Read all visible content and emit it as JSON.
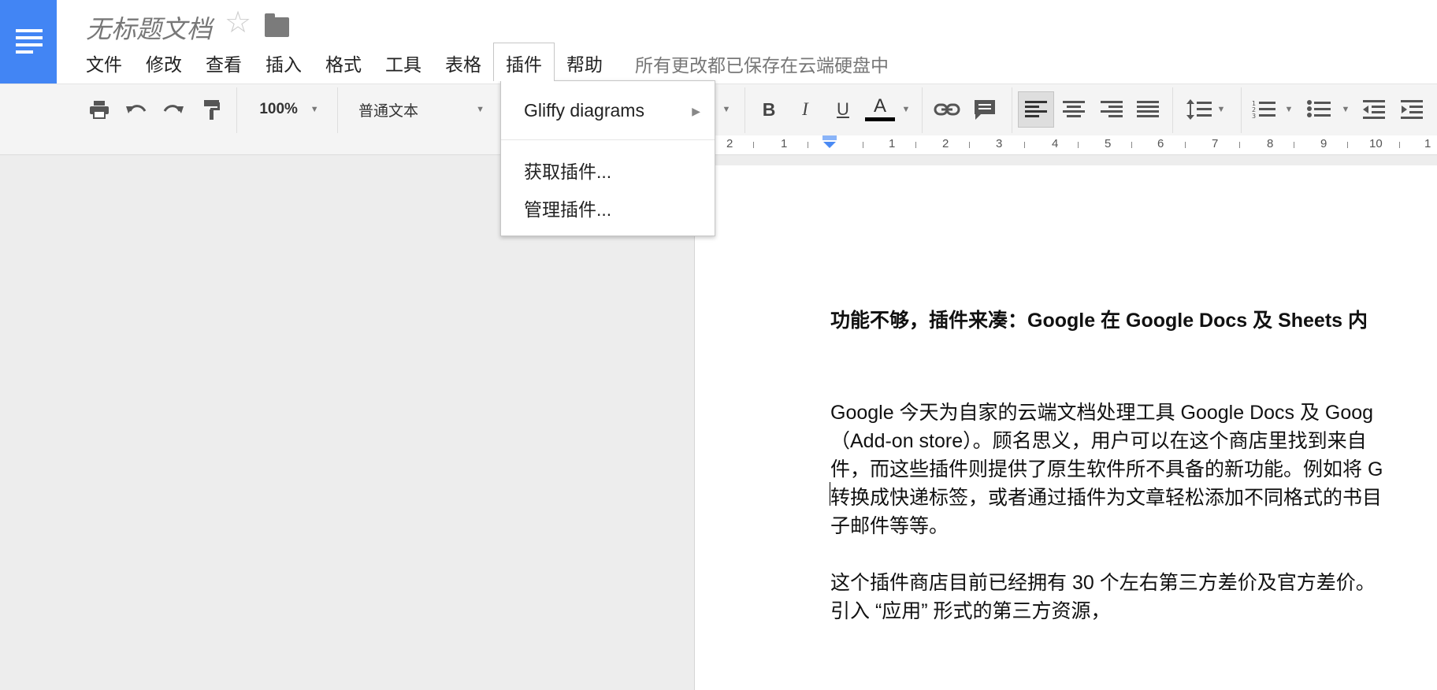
{
  "app": {
    "doc_title": "无标题文档",
    "save_status": "所有更改都已保存在云端硬盘中"
  },
  "menubar": {
    "items": [
      "文件",
      "修改",
      "查看",
      "插入",
      "格式",
      "工具",
      "表格",
      "插件",
      "帮助"
    ]
  },
  "toolbar": {
    "zoom": "100%",
    "style": "普通文本"
  },
  "addon_menu": {
    "gliffy": "Gliffy diagrams",
    "get_addons": "获取插件...",
    "manage_addons": "管理插件..."
  },
  "ruler": {
    "labels": [
      "2",
      "1",
      "1",
      "2",
      "3",
      "4",
      "5",
      "6",
      "7",
      "8",
      "9",
      "10",
      "1"
    ]
  },
  "document": {
    "heading": "功能不够，插件来凑：Google 在 Google Docs 及 Sheets 内",
    "paragraph1": [
      "Google 今天为自家的云端文档处理工具 Google Docs 及 Goog",
      "（Add-on store）。顾名思义，用户可以在这个商店里找到来自",
      "件，而这些插件则提供了原生软件所不具备的新功能。例如将 G",
      "转换成快递标签，或者通过插件为文章轻松添加不同格式的书目",
      "子邮件等等。"
    ],
    "paragraph2": [
      "这个插件商店目前已经拥有 30 个左右第三方差价及官方差价。",
      "引入 “应用” 形式的第三方资源，"
    ]
  },
  "colors": {
    "brand": "#4285f4",
    "menu_bg": "#ffffff",
    "toolbar_bg": "#f4f4f4",
    "page_bg": "#ededed"
  }
}
